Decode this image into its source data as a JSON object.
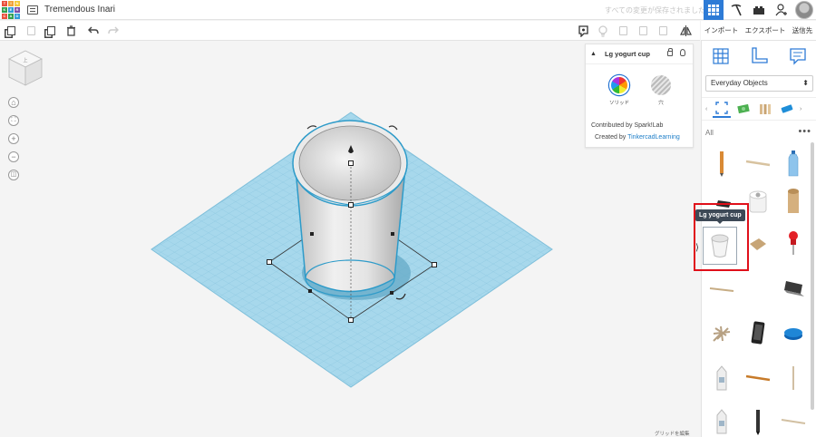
{
  "app": {
    "logo_letters": [
      "T",
      "I",
      "N",
      "K",
      "E",
      "R",
      "C",
      "A",
      "D"
    ],
    "logo_colors": [
      "#e94f3b",
      "#f1a23a",
      "#f5c734",
      "#2f9f4d",
      "#2e9ad7",
      "#7e4ea6",
      "#e94f3b",
      "#2f9f4d",
      "#2e9ad7"
    ],
    "design_title": "Tremendous Inari",
    "save_status": "すべての変更が保存されました",
    "accent": "#2d7bd6"
  },
  "actions": {
    "import": "インポート",
    "export": "エクスポート",
    "send_to": "送信先"
  },
  "inspector": {
    "title": "Lg yogurt cup",
    "solid_label": "ソリッド",
    "hole_label": "穴",
    "contributed": "Contributed by Spark!Lab",
    "created_prefix": "Created by ",
    "created_link": "TinkercadLearning"
  },
  "library": {
    "category": "Everyday Objects",
    "section": "All",
    "more": "•••",
    "hovered_shape": "Lg yogurt cup"
  },
  "footer": {
    "grid_edit": "グリッドを編集"
  }
}
